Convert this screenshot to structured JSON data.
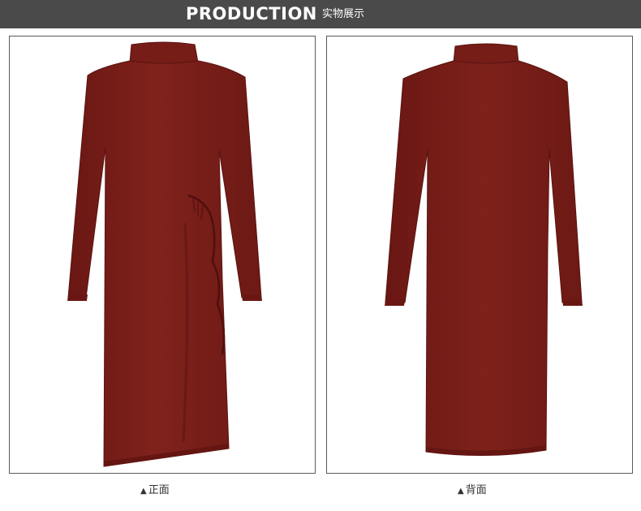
{
  "header": {
    "title": "PRODUCTION",
    "subtitle": "实物展示",
    "background_color": "#4a4a4a"
  },
  "panels": [
    {
      "view": "front",
      "caption_marker": "▲",
      "caption": "正面",
      "garment_color": "#7a1e1a",
      "image_subject": "burgundy knit mock-neck long-sleeve midi dress with side drawstring tie, front view"
    },
    {
      "view": "back",
      "caption_marker": "▲",
      "caption": "背面",
      "garment_color": "#7a1e1a",
      "image_subject": "burgundy knit mock-neck long-sleeve midi dress, back view"
    }
  ]
}
